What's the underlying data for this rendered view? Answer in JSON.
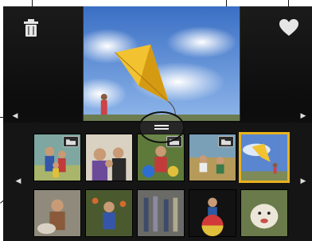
{
  "icons": {
    "trash": "trash-icon",
    "share": "share-icon",
    "favorite": "heart-icon",
    "folder": "folder-icon",
    "scroll_left": "chevron-left-icon",
    "scroll_right": "chevron-right-icon",
    "drag_handle": "drag-handle-icon"
  },
  "arrows": {
    "left_glyph": "◀",
    "right_glyph": "▶"
  },
  "colors": {
    "selection": "#e8b21e",
    "background": "#121212"
  },
  "thumbnails": [
    {
      "scene": "family-group",
      "folder": true
    },
    {
      "scene": "mother-and-kids",
      "folder": false
    },
    {
      "scene": "child-with-balls",
      "folder": true
    },
    {
      "scene": "kids-on-grass",
      "folder": true
    },
    {
      "scene": "kite-beach",
      "folder": false,
      "selected": true
    },
    {
      "scene": "girl-with-dog",
      "folder": false
    },
    {
      "scene": "boy-with-flowers",
      "folder": false
    },
    {
      "scene": "legs-group",
      "folder": false
    },
    {
      "scene": "child-on-ball",
      "folder": false
    },
    {
      "scene": "dog-smiling",
      "folder": false
    }
  ]
}
